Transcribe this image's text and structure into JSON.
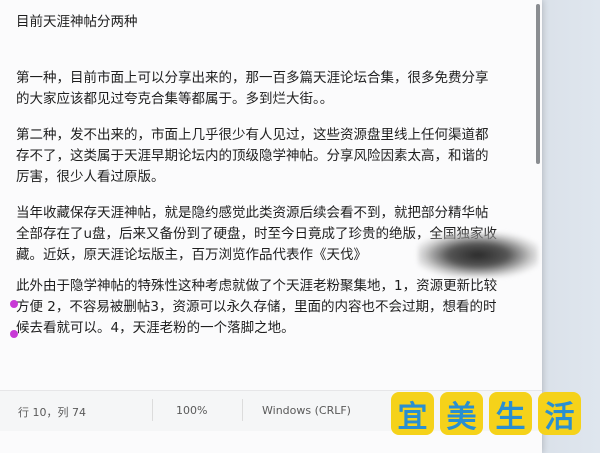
{
  "document": {
    "lines": [
      "目前天涯神帖分两种",
      "第一种，目前市面上可以分享出来的，那一百多篇天涯论坛合集，很多免费分享",
      "的大家应该都见过夸克合集等都属于。多到烂大街。。",
      "第二种，发不出来的，市面上几乎很少有人见过，这些资源盘里线上任何渠道都",
      "存不了，这类属于天涯早期论坛内的顶级隐学神帖。分享风险因素太高，和谐的",
      "厉害，很少人看过原版。",
      "当年收藏保存天涯神帖，就是隐约感觉此类资源后续会看不到，就把部分精华帖",
      "全部存在了u盘，后来又备份到了硬盘，时至今日竟成了珍贵的绝版，全国独家收",
      "藏。近妖，原天涯论坛版主，百万浏览作品代表作《天伐》",
      "此外由于隐学神帖的特殊性这种考虑就做了个天涯老粉聚集地，1，资源更新比较",
      "方便 2，不容易被删帖3，资源可以永久存储，里面的内容也不会过期，想看的时",
      "候去看就可以。4，天涯老粉的一个落脚之地。"
    ]
  },
  "statusbar": {
    "position": "行 10，列 74",
    "zoom": "100%",
    "line_ending": "Windows (CRLF)"
  },
  "watermark": {
    "chars": [
      "宜",
      "美",
      "生",
      "活"
    ],
    "bg_color": "#f5d21a",
    "text_color": "#2a8fd0"
  }
}
